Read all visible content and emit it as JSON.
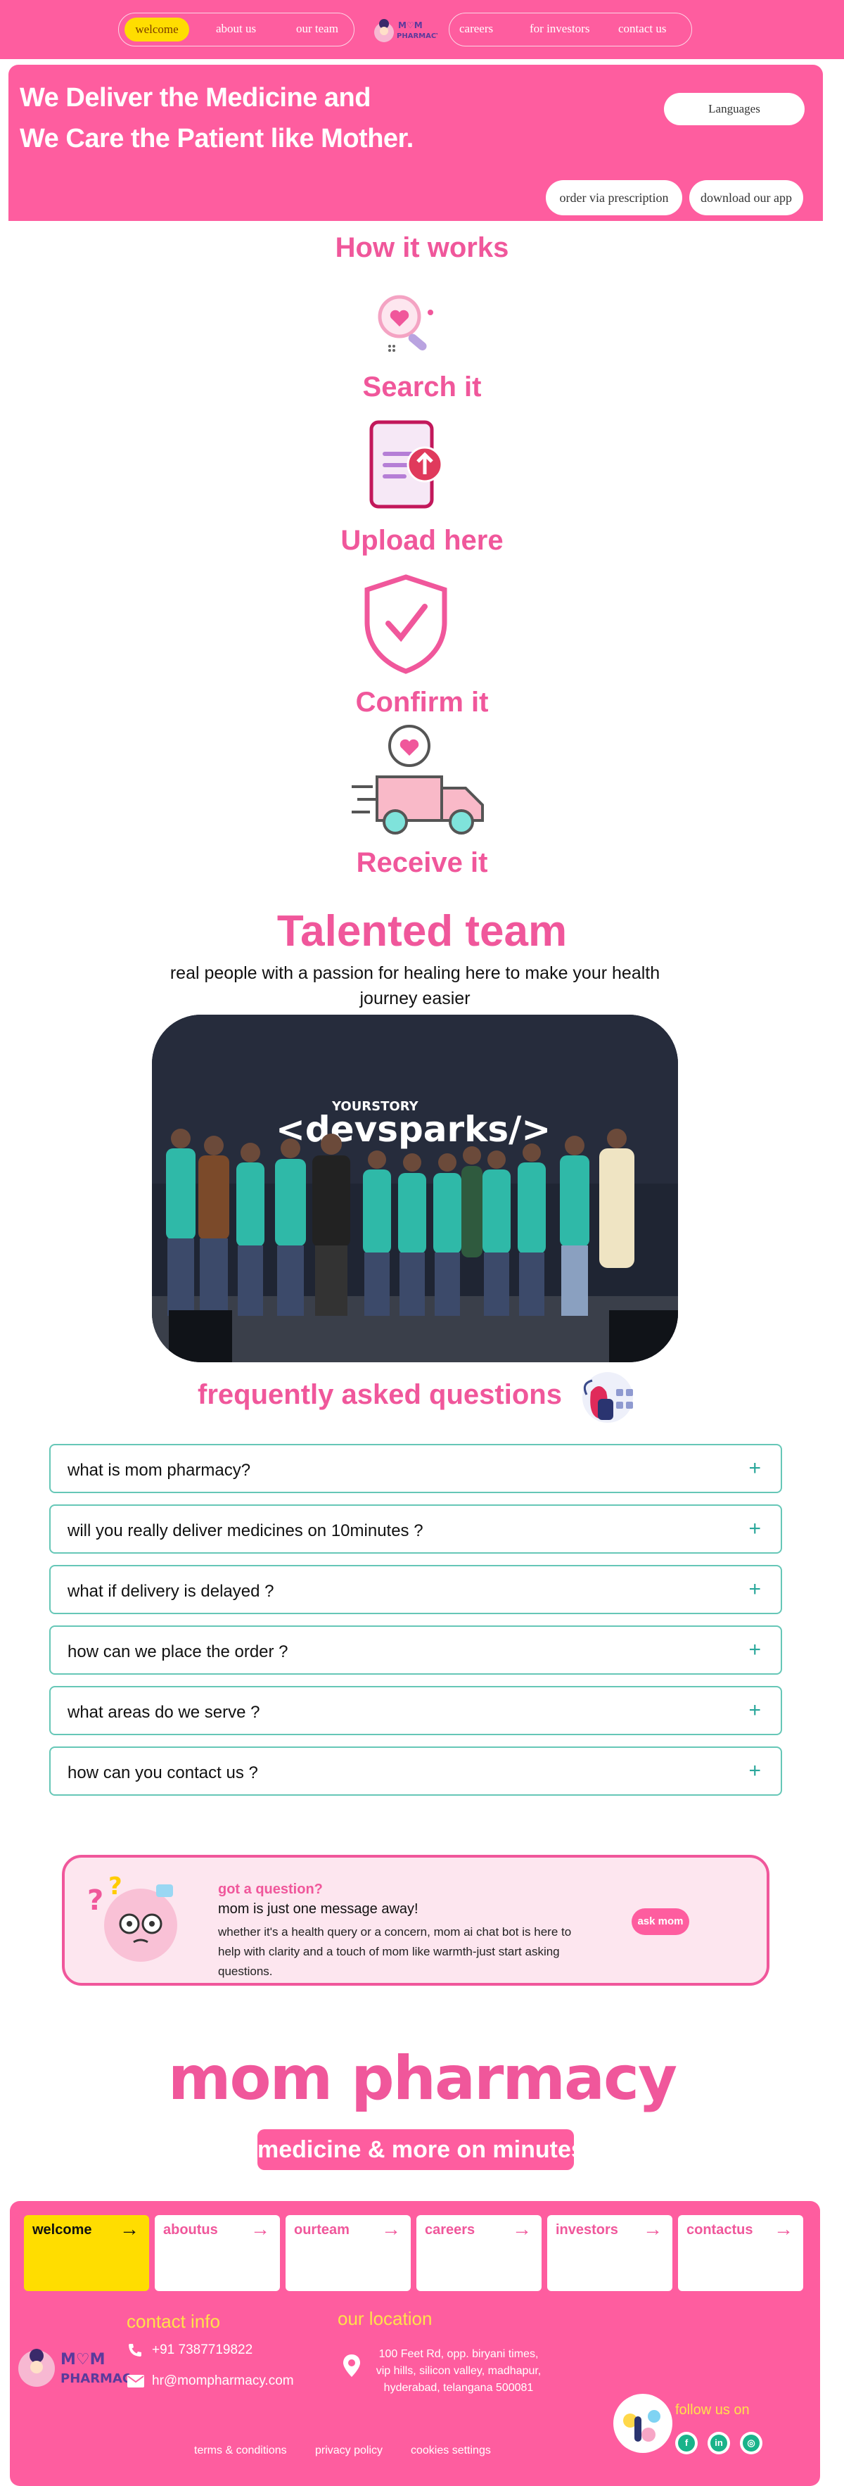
{
  "nav": {
    "left": [
      "welcome",
      "about us",
      "our team"
    ],
    "right": [
      "careers",
      "for investors",
      "contact us"
    ],
    "logo_text": [
      "M♡M",
      "PHARMACY"
    ]
  },
  "hero": {
    "line1": "We Deliver the Medicine and",
    "line2": "We Care the Patient like  Mother.",
    "languages": "Languages",
    "prescription": "order via prescription",
    "download": "download our app"
  },
  "how": {
    "title": "How it works",
    "steps": [
      "Search it",
      "Upload here",
      "Confirm it",
      "Receive it"
    ]
  },
  "team": {
    "title": "Talented team",
    "subtitle": "real people with a passion for healing here to make your health journey easier",
    "banner_small": "YOURSTORY",
    "banner_big": "<devsparks/>"
  },
  "faq": {
    "title": "frequently asked questions",
    "items": [
      "what is mom pharmacy?",
      "will you really deliver medicines on 10minutes ?",
      "what if delivery is delayed ?",
      "how can we place the order ?",
      "what areas do we serve ?",
      "how can you contact us ?"
    ]
  },
  "ask": {
    "heading": "got a question?",
    "subheading": "mom is just one message away!",
    "body": "whether it's a health query or a concern, mom ai chat bot is here to help with clarity and a touch of mom like warmth-just start asking questions.",
    "button": "ask mom"
  },
  "brand": {
    "name": "mom pharmacy",
    "tagline": "medicine & more on minutes"
  },
  "footer": {
    "tiles": [
      "welcome",
      "aboutus",
      "ourteam",
      "careers",
      "investors",
      "contactus"
    ],
    "contact_title": "contact info",
    "phone": "+91 7387719822",
    "email": "hr@mompharmacy.com",
    "location_title": "our location",
    "address": [
      "100 Feet Rd, opp. biryani times,",
      "vip hills, silicon valley, madhapur,",
      "hyderabad, telangana 500081"
    ],
    "follow": "follow us on",
    "links": [
      "terms & conditions",
      "privacy policy",
      "cookies settings"
    ]
  },
  "colors": {
    "primary": "#fe5d9f",
    "accent": "#ffdd00",
    "heading": "#f0579b",
    "faq_border": "#66c7b7"
  }
}
